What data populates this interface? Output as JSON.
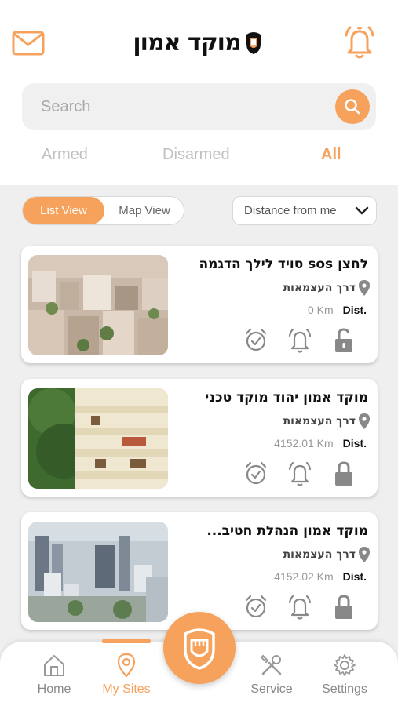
{
  "header": {
    "logo_text": "מוקד אמון",
    "icons": {
      "mail": "mail-icon",
      "notifications": "bell-icon"
    }
  },
  "colors": {
    "accent": "#f6a25d",
    "inactive": "#c0c0c0",
    "icon_gray": "#888888"
  },
  "search": {
    "placeholder": "Search",
    "value": ""
  },
  "filter_tabs": [
    {
      "label": "Armed",
      "active": false
    },
    {
      "label": "Disarmed",
      "active": false
    },
    {
      "label": "All",
      "active": true
    }
  ],
  "view_toggle": {
    "list": "List View",
    "map": "Map View",
    "selected": "List View"
  },
  "sort": {
    "selected": "Distance from me"
  },
  "sites": [
    {
      "title": "לחצן sos סויד לילך הדגמה",
      "address": "דרך העצמאות",
      "distance": "0 Km",
      "dist_label": "Dist.",
      "lock_state": "unlocked"
    },
    {
      "title": "מוקד אמון יהוד מוקד טכני",
      "address": "דרך העצמאות",
      "distance": "4152.01 Km",
      "dist_label": "Dist.",
      "lock_state": "locked"
    },
    {
      "title": "מוקד אמון הנהלת חטיב...",
      "address": "דרך העצמאות",
      "distance": "4152.02 Km",
      "dist_label": "Dist.",
      "lock_state": "locked"
    }
  ],
  "bottom_nav": {
    "items": [
      {
        "label": "Home",
        "icon": "home-icon"
      },
      {
        "label": "My Sites",
        "icon": "pin-icon",
        "active": true
      },
      {
        "label": "Service",
        "icon": "tools-icon"
      },
      {
        "label": "Settings",
        "icon": "gear-icon"
      }
    ],
    "center_button_icon": "fist-shield-icon"
  }
}
